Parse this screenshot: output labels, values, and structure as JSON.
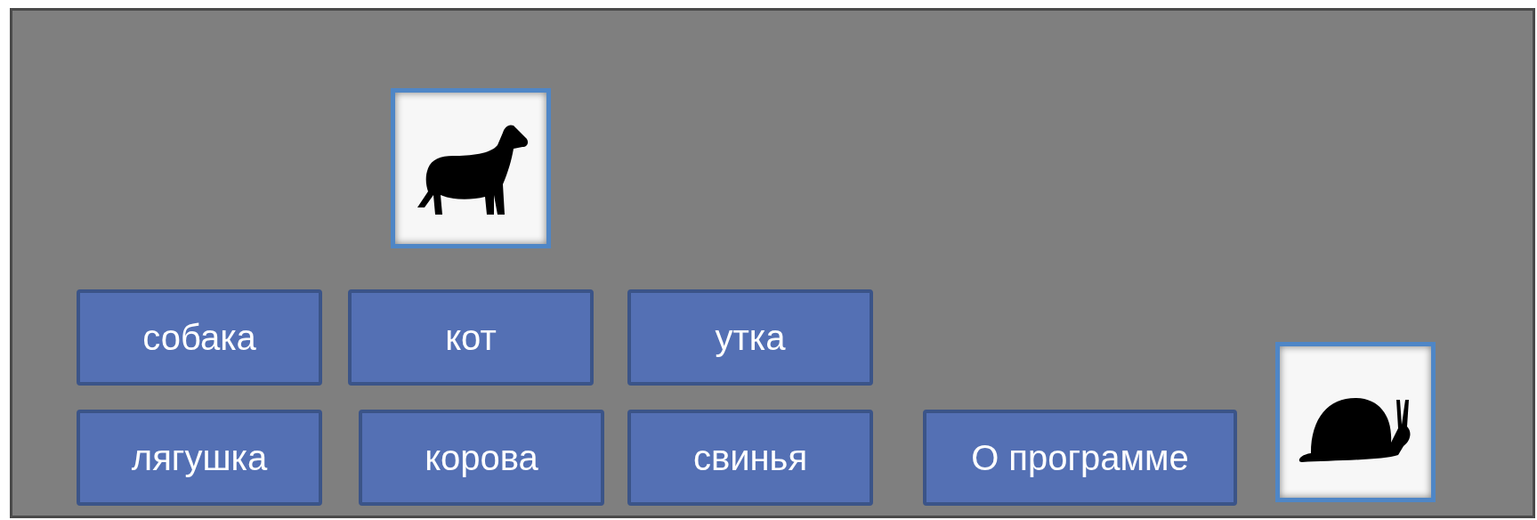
{
  "buttons": [
    {
      "label": "собака"
    },
    {
      "label": "кот"
    },
    {
      "label": "утка"
    },
    {
      "label": "лягушка"
    },
    {
      "label": "корова"
    },
    {
      "label": "свинья"
    },
    {
      "label": "О программе"
    }
  ]
}
